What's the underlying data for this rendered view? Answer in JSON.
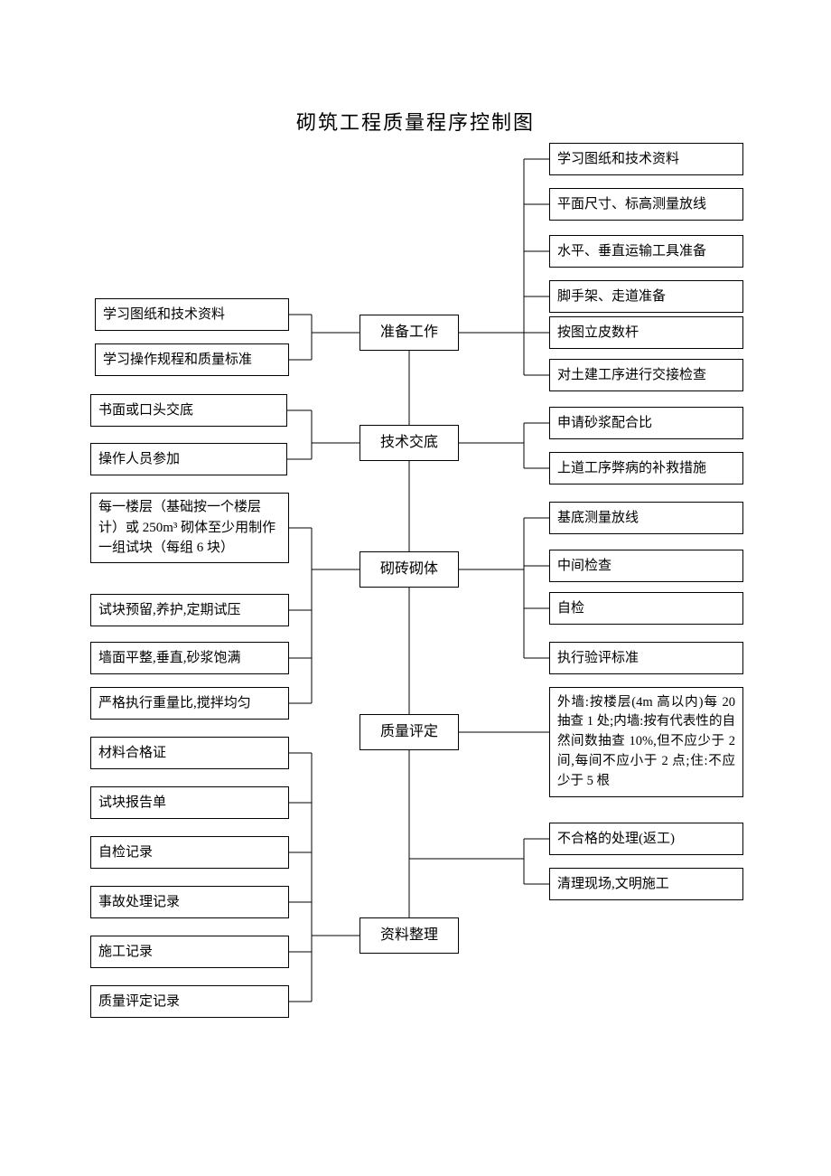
{
  "title": "砌筑工程质量程序控制图",
  "center": {
    "c1": "准备工作",
    "c2": "技术交底",
    "c3": "砌砖砌体",
    "c4": "质量评定",
    "c5": "资料整理"
  },
  "left": {
    "l1": "学习图纸和技术资料",
    "l2": "学习操作规程和质量标准",
    "l3": "书面或口头交底",
    "l4": "操作人员参加",
    "l5": "每一楼层（基础按一个楼层计）或 250m³ 砌体至少用制作一组试块（每组 6 块）",
    "l6": "试块预留,养护,定期试压",
    "l7": "墙面平整,垂直,砂浆饱满",
    "l8": "严格执行重量比,搅拌均匀",
    "l9": "材料合格证",
    "l10": "试块报告单",
    "l11": "自检记录",
    "l12": "事故处理记录",
    "l13": "施工记录",
    "l14": "质量评定记录"
  },
  "right": {
    "r1": "学习图纸和技术资料",
    "r2": "平面尺寸、标高测量放线",
    "r3": "水平、垂直运输工具准备",
    "r4": "脚手架、走道准备",
    "r5": "按图立皮数杆",
    "r6": "对土建工序进行交接检查",
    "r7": "申请砂浆配合比",
    "r8": "上道工序弊病的补救措施",
    "r9": "基底测量放线",
    "r10": "中间检查",
    "r11": "自检",
    "r12": "执行验评标准",
    "r13": "外墙:按楼层(4m 高以内)每 20 抽查 1 处;内墙:按有代表性的自然间数抽查 10%,但不应少于 2 间,每间不应小于 2 点;住:不应少于 5 根",
    "r14": "不合格的处理(返工)",
    "r15": "清理现场,文明施工"
  }
}
